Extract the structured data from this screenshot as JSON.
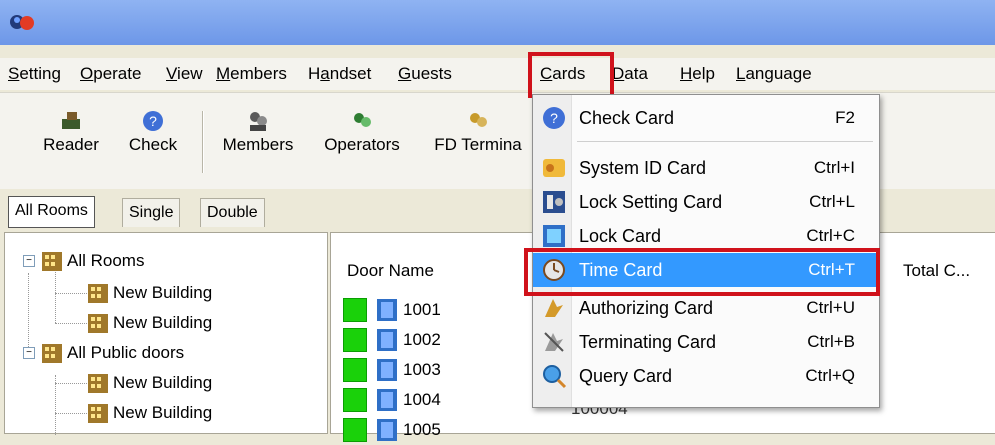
{
  "menubar": [
    {
      "pre": "",
      "u": "S",
      "post": "etting"
    },
    {
      "pre": "",
      "u": "O",
      "post": "perate"
    },
    {
      "pre": "",
      "u": "V",
      "post": "iew"
    },
    {
      "pre": "",
      "u": "M",
      "post": "embers"
    },
    {
      "pre": "H",
      "u": "a",
      "post": "ndset"
    },
    {
      "pre": "",
      "u": "G",
      "post": "uests"
    },
    {
      "pre": "",
      "u": "C",
      "post": "ards"
    },
    {
      "pre": "",
      "u": "D",
      "post": "ata"
    },
    {
      "pre": "",
      "u": "H",
      "post": "elp"
    },
    {
      "pre": "",
      "u": "L",
      "post": "anguage"
    }
  ],
  "toolbar": {
    "reader": "Reader",
    "check": "Check",
    "members": "Members",
    "operators": "Operators",
    "fd_terminal": "FD Termina"
  },
  "tabs": [
    "All Rooms",
    "Single",
    "Double"
  ],
  "tree": {
    "all_rooms": "All Rooms",
    "building1": "New Building",
    "building2": "New Building",
    "public": "All Public doors",
    "building3": "New Building",
    "building4": "New Building"
  },
  "list": {
    "col_door": "Door Name",
    "col_total": "Total C...",
    "rows": [
      "1001",
      "1002",
      "1003",
      "1004",
      "1005"
    ],
    "cut_text": "100004"
  },
  "cards_menu": [
    {
      "label": "Check Card",
      "key": "F2",
      "icon": "check-card-icon"
    },
    {
      "label": "System ID Card",
      "key": "Ctrl+I",
      "icon": "system-id-card-icon"
    },
    {
      "label": "Lock Setting Card",
      "key": "Ctrl+L",
      "icon": "lock-setting-card-icon"
    },
    {
      "label": "Lock Card",
      "key": "Ctrl+C",
      "icon": "lock-card-icon"
    },
    {
      "label": "Time Card",
      "key": "Ctrl+T",
      "icon": "time-card-icon"
    },
    {
      "label": "Authorizing Card",
      "key": "Ctrl+U",
      "icon": "authorizing-card-icon"
    },
    {
      "label": "Terminating Card",
      "key": "Ctrl+B",
      "icon": "terminating-card-icon"
    },
    {
      "label": "Query Card",
      "key": "Ctrl+Q",
      "icon": "query-card-icon"
    }
  ],
  "colors": {
    "highlight_box": "#d0121b",
    "menu_selected": "#3399ff",
    "status_ok": "#1ad10a",
    "titlebar": "#7aa2ee"
  }
}
